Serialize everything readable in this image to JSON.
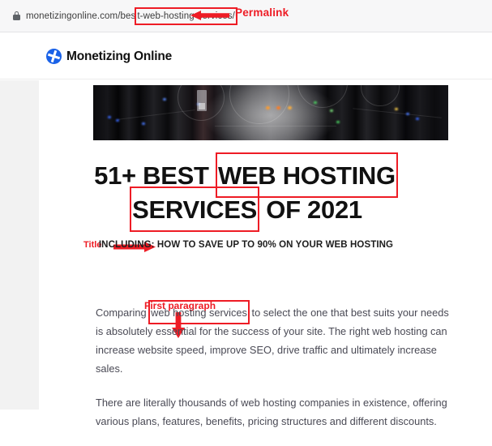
{
  "browser": {
    "lock_icon": "lock-icon",
    "url_prefix": "monetizingonline.com/bes",
    "url_highlighted": "t-web-hosting-services/",
    "url_full": "monetizingonline.com/best-web-hosting-services/"
  },
  "annotations": {
    "permalink": {
      "label": "Permalink",
      "arrow": "arrow-left-icon",
      "color": "#ee1c25"
    },
    "title": {
      "label": "Title",
      "arrow": "arrow-right-icon",
      "color": "#ee1c25"
    },
    "first_paragraph": {
      "label": "First paragraph",
      "arrow": "arrow-down-icon",
      "color": "#ee1c25"
    }
  },
  "site": {
    "logo_icon": "monetizing-online-logo-icon",
    "logo_text": "Monetizing Online",
    "logo_color": "#1a62e8",
    "hero_alt": "data-center-server-room-banner"
  },
  "article": {
    "headline": {
      "line1_a": "51+ BEST ",
      "line1_boxed": "WEB HOSTING",
      "line2_boxed": "SERVICES",
      "line2_b": " OF 2021",
      "full": "51+ BEST WEB HOSTING SERVICES OF 2021"
    },
    "subheadline": "INCLUDING: HOW TO SAVE UP TO 90% ON YOUR WEB HOSTING",
    "paragraph1": {
      "before": "Comparing ",
      "boxed": "web hosting services",
      "after": " to select the one that best suits your needs is absolutely essential for the success of your site. The right web hosting can increase website speed, improve SEO, drive traffic and ultimately increase sales."
    },
    "paragraph2": "There are literally thousands of web hosting companies in existence, offering various plans, features, benefits, pricing structures and different discounts."
  }
}
